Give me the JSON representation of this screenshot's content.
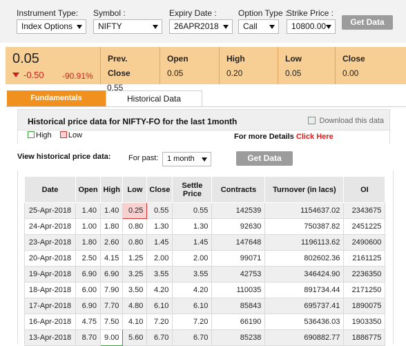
{
  "filters": {
    "instrument_type": {
      "label": "Instrument Type:",
      "value": "Index Options"
    },
    "symbol": {
      "label": "Symbol :",
      "value": "NIFTY"
    },
    "expiry_date": {
      "label": "Expiry Date :",
      "value": "26APR2018"
    },
    "option_type": {
      "label": "Option Type :",
      "value": "Call"
    },
    "strike_price": {
      "label": "Strike Price :",
      "value": "10800.00"
    },
    "get_data_label": "Get Data"
  },
  "quote": {
    "last_price": "0.05",
    "change": "-0.50",
    "change_pct": "-90.91%",
    "prev_close_label_1": "Prev.",
    "prev_close_label_2": "Close",
    "prev_close_value": "0.55",
    "open_label": "Open",
    "open_value": "0.05",
    "high_label": "High",
    "high_value": "0.20",
    "low_label": "Low",
    "low_value": "0.05",
    "close_label": "Close",
    "close_value": "0.00",
    "colors": {
      "change": "#cc1f1f",
      "background": "#f7cf94"
    }
  },
  "tabs": {
    "fundamentals": "Fundamentals",
    "historical": "Historical Data"
  },
  "historical": {
    "title": "Historical price data for NIFTY-FO for the last 1month",
    "download_label": "Download this data",
    "legend_high": "High",
    "legend_low": "Low",
    "more_details_text": "For more Details",
    "click_here": "Click Here",
    "view_label": "View historical price data:",
    "for_past_label": "For past:",
    "period_value": "1 month",
    "get_data_label": "Get Data"
  },
  "table": {
    "columns": [
      "Date",
      "Open",
      "High",
      "Low",
      "Close",
      "Settle Price",
      "Contracts",
      "Turnover (in lacs)",
      "OI"
    ],
    "rows": [
      [
        "25-Apr-2018",
        "1.40",
        "1.40",
        "0.25",
        "0.55",
        "0.55",
        "142539",
        "1154637.02",
        "2343675"
      ],
      [
        "24-Apr-2018",
        "1.00",
        "1.80",
        "0.80",
        "1.30",
        "1.30",
        "92630",
        "750387.82",
        "2451225"
      ],
      [
        "23-Apr-2018",
        "1.80",
        "2.60",
        "0.80",
        "1.45",
        "1.45",
        "147648",
        "1196113.62",
        "2490600"
      ],
      [
        "20-Apr-2018",
        "2.50",
        "4.15",
        "1.25",
        "2.00",
        "2.00",
        "99071",
        "802602.36",
        "2161125"
      ],
      [
        "19-Apr-2018",
        "6.90",
        "6.90",
        "3.25",
        "3.55",
        "3.55",
        "42753",
        "346424.90",
        "2236350"
      ],
      [
        "18-Apr-2018",
        "6.00",
        "7.90",
        "3.50",
        "4.20",
        "4.20",
        "110035",
        "891734.44",
        "2171250"
      ],
      [
        "17-Apr-2018",
        "6.90",
        "7.70",
        "4.80",
        "6.10",
        "6.10",
        "85843",
        "695737.41",
        "1890075"
      ],
      [
        "16-Apr-2018",
        "4.75",
        "7.50",
        "4.10",
        "7.20",
        "7.20",
        "66190",
        "536436.03",
        "1903350"
      ],
      [
        "13-Apr-2018",
        "8.70",
        "9.00",
        "5.60",
        "6.70",
        "6.70",
        "85238",
        "690882.77",
        "1886775"
      ]
    ]
  }
}
